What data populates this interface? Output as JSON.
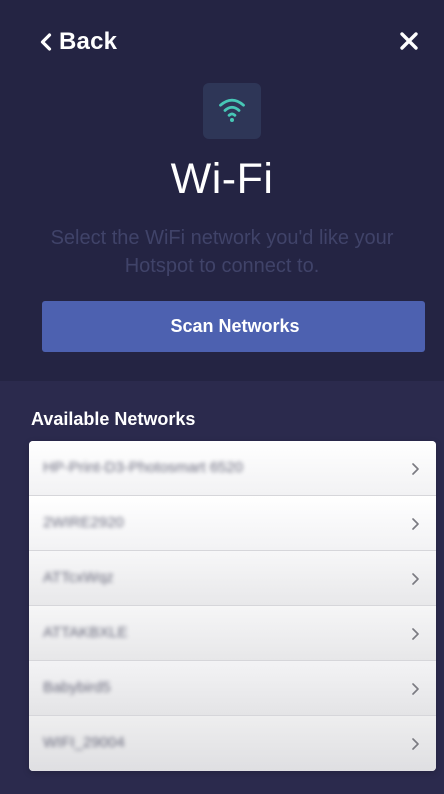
{
  "header": {
    "back_label": "Back",
    "back_icon": "chevron-left-icon",
    "close_icon": "close-icon"
  },
  "hero": {
    "icon": "wifi-icon",
    "title": "Wi-Fi",
    "subtitle_line1": "Select the WiFi network you'd like your",
    "subtitle_line2": "Hotspot to connect to."
  },
  "actions": {
    "scan_label": "Scan Networks"
  },
  "networks": {
    "title": "Available Networks",
    "items": [
      {
        "name": "HP-Print-D3-Photosmart 6520"
      },
      {
        "name": "2WIRE2920"
      },
      {
        "name": "ATTcxWqz"
      },
      {
        "name": "ATTAKBXLE"
      },
      {
        "name": "Babybird5"
      },
      {
        "name": "WIFI_29004"
      }
    ]
  },
  "colors": {
    "background_dark": "#242443",
    "background_list_area": "#2b2a4d",
    "primary_button": "#4d61b0",
    "wifi_accent": "#47c7b6",
    "subtitle_text": "#404369"
  }
}
